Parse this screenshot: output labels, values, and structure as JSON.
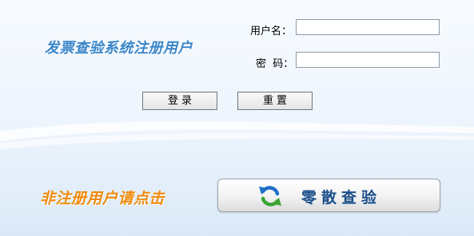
{
  "login": {
    "title": "发票查验系统注册用户",
    "username_label": "用户名：",
    "password_label": "密  码：",
    "username_value": "",
    "password_value": "",
    "login_button": "登录",
    "reset_button": "重置"
  },
  "guest": {
    "notice": "非注册用户请点击",
    "query_button": "零散查验",
    "icon": "refresh-arrows-icon"
  },
  "colors": {
    "title": "#3b86c9",
    "notice": "#f18a0b",
    "query_text": "#1b4f8a",
    "icon_blue": "#1f6fc9",
    "icon_green": "#3aa534"
  }
}
